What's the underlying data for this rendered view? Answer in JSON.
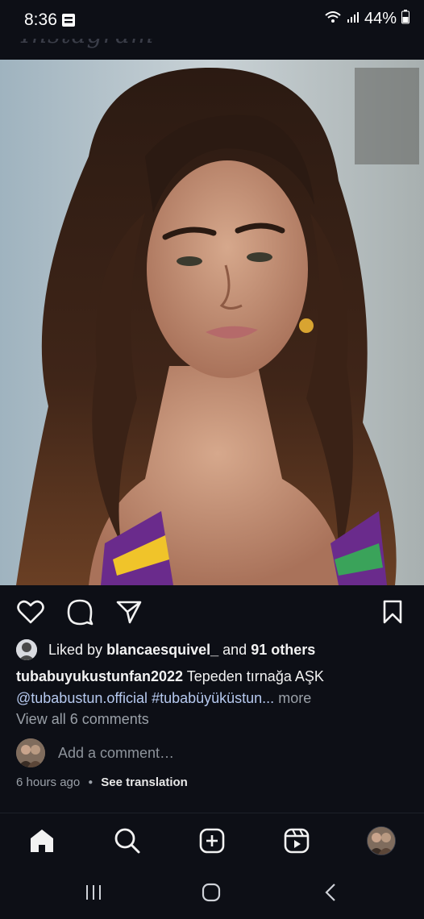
{
  "status_bar": {
    "time": "8:36",
    "battery": "44%",
    "icons": [
      "notification-icon",
      "wifi-icon",
      "signal-icon",
      "battery-icon"
    ]
  },
  "header": {
    "logo": "Instagram",
    "icons": [
      "chevron-down-icon",
      "heart-icon",
      "messenger-icon"
    ]
  },
  "post": {
    "image_description": "portrait photo",
    "actions": {
      "icons": [
        "like-heart-icon",
        "comment-icon",
        "share-icon",
        "save-bookmark-icon"
      ]
    },
    "likes": {
      "prefix": "Liked by",
      "user": "blancaesquivel_",
      "and": "and",
      "others": "91 others"
    },
    "caption": {
      "username": "tubabuyukustunfan2022",
      "text": "Tepeden tırnağa AŞK",
      "mention": "@tubabustun.official",
      "hashtag": "#tubabüyüküstun...",
      "more": "more"
    },
    "view_comments": "View all 6 comments",
    "add_comment_placeholder": "Add a comment…",
    "time_ago": "6 hours ago",
    "see_translation": "See translation"
  },
  "bottom_nav": {
    "items": [
      "home-icon",
      "search-icon",
      "create-icon",
      "reels-icon",
      "profile-avatar"
    ]
  },
  "system_nav": {
    "items": [
      "recents-icon",
      "home-circle-icon",
      "back-icon"
    ]
  },
  "colors": {
    "background": "#0d0f16",
    "text": "#f2f2f2",
    "link": "#b6c9ef",
    "muted": "#9aa0a8"
  }
}
